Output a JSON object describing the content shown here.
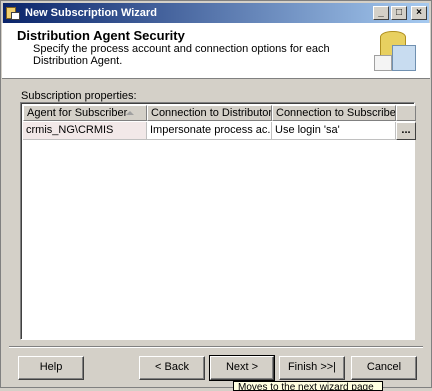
{
  "window": {
    "title": "New Subscription Wizard",
    "controls": {
      "minimize": "_",
      "maximize": "□",
      "close": "×"
    }
  },
  "header": {
    "title": "Distribution Agent Security",
    "description": "Specify the process account and connection options for each Distribution Agent."
  },
  "subscription_properties": {
    "label": "Subscription properties:",
    "columns": [
      "Agent for Subscriber",
      "Connection to Distributor",
      "Connection to Subscriber"
    ],
    "sorted_column_icon": "sort-asc-icon",
    "rows": [
      {
        "agent": "crmis_NG\\CRMIS",
        "distributor_connection": "Impersonate process ac...",
        "subscriber_connection": "Use login 'sa'",
        "edit_button": "..."
      }
    ]
  },
  "buttons": {
    "help": "Help",
    "back": "< Back",
    "next": "Next >",
    "finish": "Finish >>|",
    "cancel": "Cancel"
  },
  "tooltip": "Moves to the next wizard page"
}
